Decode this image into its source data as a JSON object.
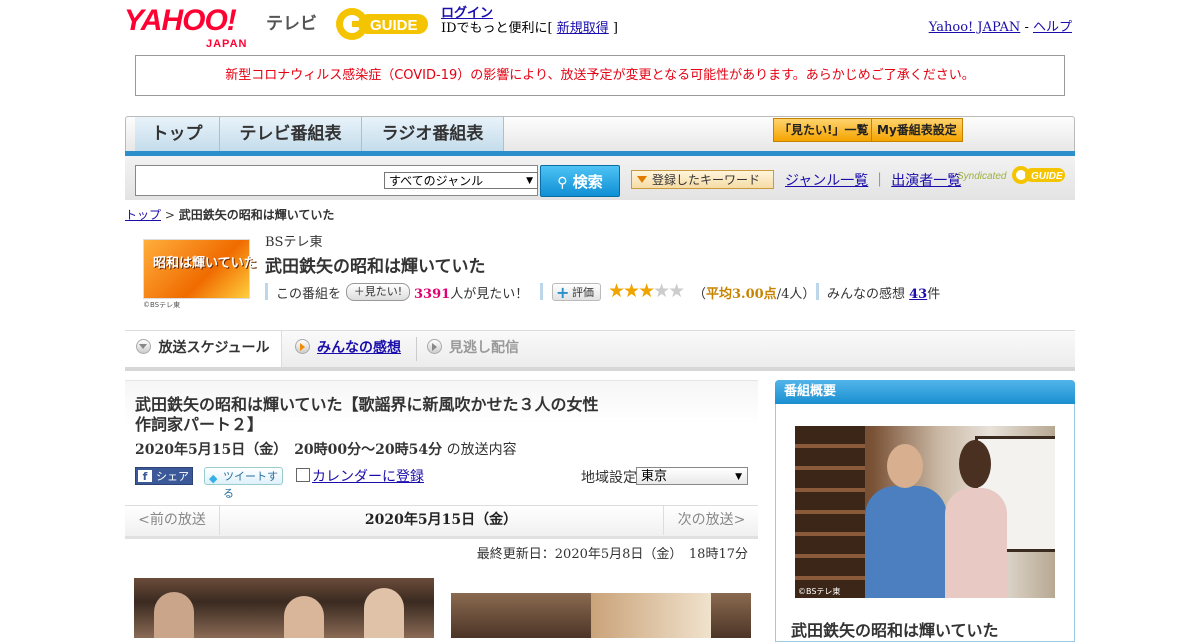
{
  "header": {
    "yahoo_logo": "YAHOO!",
    "yahoo_logo_sub": "JAPAN",
    "tv_label": "テレビ",
    "gguide_logo": "GUIDE",
    "login_link": "ログイン",
    "login_note_prefix": "IDでもっと便利に[ ",
    "signup_link": "新規取得",
    "login_note_suffix": " ]",
    "yahoo_japan_link": "Yahoo! JAPAN",
    "separator": " - ",
    "help_link": "ヘルプ"
  },
  "notice": "新型コロナウィルス感染症（COVID-19）の影響により、放送予定が変更となる可能性があります。あらかじめご了承ください。",
  "nav": {
    "tabs": [
      "トップ",
      "テレビ番組表",
      "ラジオ番組表"
    ],
    "mitai_button": "「見たい!」一覧",
    "my_bangumi_button": "My番組表設定"
  },
  "search": {
    "input_value": "",
    "genre_selected": "すべてのジャンル",
    "search_button": "検索",
    "keyword_button": "登録したキーワード",
    "genre_list_link": "ジャンル一覧",
    "links_separator": "｜",
    "performer_list_link": "出演者一覧",
    "syndicated_label": "Syndicated",
    "syndicated_logo": "GUIDE"
  },
  "breadcrumb": {
    "top": "トップ",
    "sep": " > ",
    "current": "武田鉄矢の昭和は輝いていた"
  },
  "program": {
    "thumb_text": "昭和は輝いていた",
    "thumb_copyright": "©BSテレ東",
    "channel": "BSテレ東",
    "title": "武田鉄矢の昭和は輝いていた",
    "want_prefix": "この番組を",
    "want_button": "＋見たい!",
    "want_count": "3391",
    "want_suffix": "人が見たい！",
    "eval_button": "評価",
    "stars_on": "★★★",
    "stars_off": "★★",
    "avg_prefix": "（",
    "avg_label": "平均3.00点",
    "avg_suffix": "/4人）",
    "impressions_prefix": "みんなの感想 ",
    "impressions_count": "43",
    "impressions_suffix": "件"
  },
  "subtabs": [
    "放送スケジュール",
    "みんなの感想",
    "見逃し配信"
  ],
  "episode": {
    "title": "武田鉄矢の昭和は輝いていた【歌謡界に新風吹かせた３人の女性作詞家パート２】",
    "date": "2020年5月15日（金）　20時00分～20時54分",
    "date_suffix": "の放送内容",
    "share_fb": "シェア",
    "share_tw": "ツイートする",
    "calendar": "カレンダーに登録",
    "region_label": "地域設定",
    "region_value": "東京"
  },
  "daynav": {
    "prev": "<前の放送",
    "current": "2020年5月15日（金）",
    "next": "次の放送>"
  },
  "updated": "最終更新日：2020年5月8日（金）　18時17分",
  "side": {
    "heading": "番組概要",
    "photo_copyright": "©BSテレ東",
    "title": "武田鉄矢の昭和は輝いていた"
  },
  "colors": {
    "accent_blue": "#2a8fcb",
    "notice_red": "#e60012",
    "want_pink": "#e0006f",
    "star_orange": "#f0a400"
  }
}
